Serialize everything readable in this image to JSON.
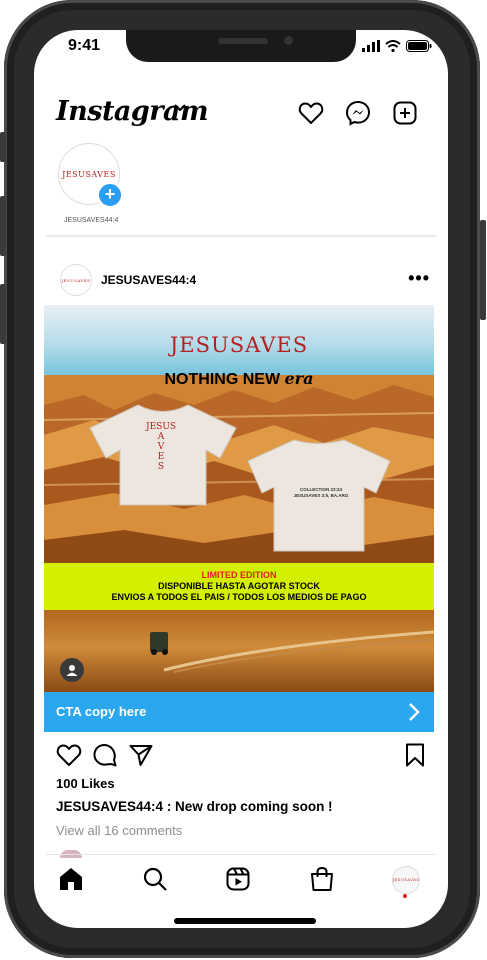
{
  "status_bar": {
    "time": "9:41"
  },
  "header": {
    "app_name": "Instagram"
  },
  "story": {
    "logo": "JESUSAVES",
    "name": "JESUSAVES44:4"
  },
  "post": {
    "username": "JESUSAVES44:4",
    "avatar_logo": "JESUSAVES",
    "image": {
      "brand": "JESUSAVES",
      "tagline_main": "NOTHING NEW ",
      "tagline_italic": "era",
      "front_tee_text": "JESUS\nA\nV\nE\nS",
      "back_tee_text": "COLLECTION 23:24\nJESUSAVES 3:5, BA.ARG",
      "banner_line1": "LIMITED EDITION",
      "banner_line2": "DISPONIBLE HASTA AGOTAR STOCK",
      "banner_line3": "ENVIOS A TODOS EL PAIS / TODOS LOS MEDIOS DE PAGO"
    },
    "cta_label": "CTA copy here",
    "likes": "100 Likes",
    "caption_user": "JESUSAVES44:4",
    "caption_text": " : New drop coming soon !",
    "comments_link": "View all 16 comments"
  },
  "tabbar": {
    "profile_logo": "JESUSAVES"
  },
  "colors": {
    "cta": "#2ba7ef",
    "banner": "#d4f000",
    "brand": "#b22222",
    "story_add": "#2a9df4"
  }
}
